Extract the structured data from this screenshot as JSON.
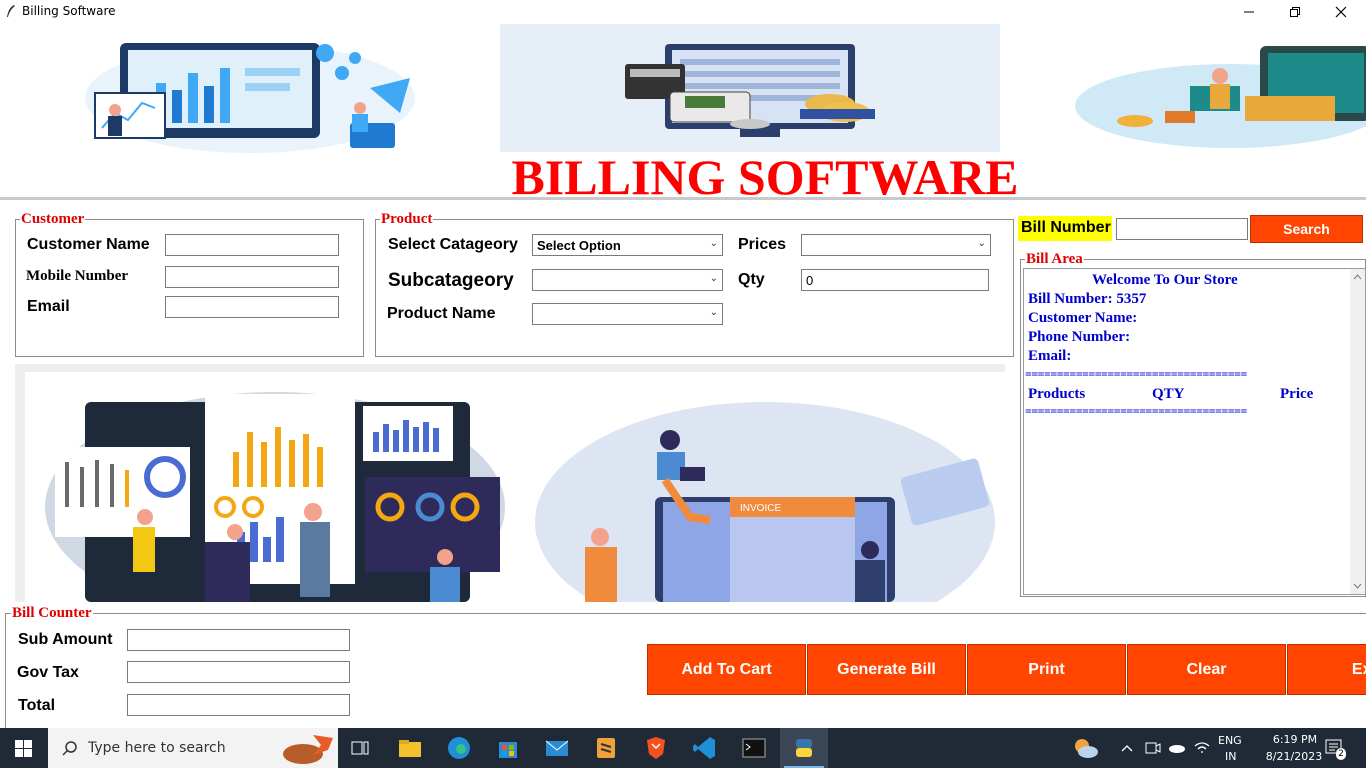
{
  "window": {
    "title": "Billing Software",
    "minimize_icon": "minimize-icon",
    "restore_icon": "restore-icon",
    "close_icon": "close-icon"
  },
  "banner": {
    "heading": "BILLING SOFTWARE"
  },
  "customer": {
    "legend": "Customer",
    "name_label": "Customer Name",
    "mobile_label": "Mobile Number",
    "email_label": "Email",
    "name_value": "",
    "mobile_value": "",
    "email_value": ""
  },
  "product": {
    "legend": "Product",
    "category_label": "Select Catageory",
    "category_value": "Select Option",
    "subcategory_label": "Subcatageory",
    "subcategory_value": "",
    "product_name_label": "Product Name",
    "product_name_value": "",
    "prices_label": "Prices",
    "prices_value": "",
    "qty_label": "Qty",
    "qty_value": "0"
  },
  "bill_search": {
    "label": "Bill Number",
    "value": "",
    "search_button": "Search"
  },
  "bill_area": {
    "legend": "Bill Area",
    "welcome": "Welcome To Our Store",
    "bill_number": "Bill Number: 5357",
    "customer_name": "Customer Name:",
    "phone_number": "Phone Number:",
    "email": "Email:",
    "separator": "===================================",
    "col_products": "Products",
    "col_qty": "QTY",
    "col_price": "Price"
  },
  "bill_counter": {
    "legend": "Bill Counter",
    "sub_amount_label": "Sub Amount",
    "gov_tax_label": "Gov Tax",
    "total_label": "Total",
    "sub_amount_value": "",
    "gov_tax_value": "",
    "total_value": ""
  },
  "actions": {
    "add_to_cart": "Add To Cart",
    "generate_bill": "Generate Bill",
    "print": "Print",
    "clear": "Clear",
    "exit": "Exit"
  },
  "taskbar": {
    "search_placeholder": "Type here to search",
    "language": "ENG",
    "region": "IN",
    "time": "6:19 PM",
    "date": "8/21/2023",
    "notification_count": "2",
    "pinned_icons": [
      "task-view-icon",
      "file-explorer-icon",
      "edge-icon",
      "store-icon",
      "mail-icon",
      "sublime-icon",
      "brave-icon",
      "vscode-icon",
      "terminal-icon",
      "python-icon"
    ]
  },
  "colors": {
    "accent_red": "#ff0000",
    "button_orange": "#ff4500",
    "bill_text_blue": "#0000cc",
    "bill_label_bg": "#ffff00"
  }
}
